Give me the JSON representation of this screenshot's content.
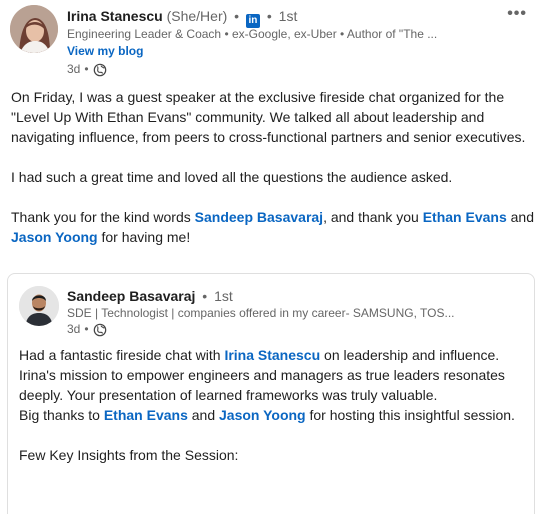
{
  "post": {
    "author": {
      "name": "Irina Stanescu",
      "pronouns": "(She/Her)",
      "linkedin_badge": "in",
      "degree": "1st",
      "headline": "Engineering Leader & Coach • ex-Google, ex-Uber • Author of \"The ...",
      "blog_link": "View my blog",
      "time": "3d"
    },
    "more_label": "•••",
    "paragraphs": [
      {
        "text": "On Friday, I was a guest speaker at the exclusive fireside chat organized for the \"Level Up With Ethan Evans\" community. We talked all about leadership and navigating influence, from peers to cross-functional partners and senior executives."
      },
      {
        "text": "I had such a great time and loved all the questions the audience asked."
      }
    ],
    "thanks": {
      "part1": "Thank you for the kind words ",
      "mention1": "Sandeep Basavaraj",
      "part2": ", and thank you ",
      "mention2": "Ethan Evans",
      "part3": " and ",
      "mention3": "Jason Yoong",
      "part4": " for having me!"
    }
  },
  "reshared": {
    "author": {
      "name": "Sandeep Basavaraj",
      "degree": "1st",
      "headline": "SDE | Technologist | companies offered in my career- SAMSUNG, TOS...",
      "time": "3d"
    },
    "p1": {
      "part1": "Had a fantastic fireside chat with ",
      "mention1": "Irina Stanescu",
      "part2": " on leadership and influence. Irina's mission to empower engineers and managers as true leaders resonates deeply. Your presentation of learned frameworks was truly valuable."
    },
    "p2": {
      "part1": "Big thanks to ",
      "mention1": "Ethan Evans",
      "part2": " and ",
      "mention2": "Jason Yoong",
      "part3": " for hosting this insightful session."
    },
    "p3": "Few Key Insights from the Session:"
  },
  "icons": {
    "more": "more-options-icon",
    "globe": "globe-icon",
    "linkedin": "linkedin-icon"
  },
  "colors": {
    "link": "#0a66c2",
    "muted": "#666666",
    "text": "#1f1f1f",
    "border": "#dfdfdf"
  }
}
